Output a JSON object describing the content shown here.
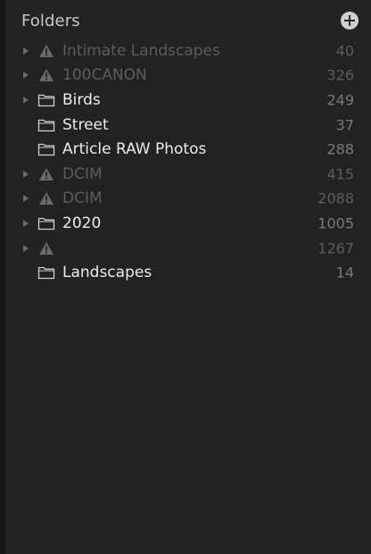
{
  "panel": {
    "title": "Folders"
  },
  "folders": [
    {
      "name": "Intimate Landscapes",
      "count": "40",
      "status": "missing",
      "expandable": true,
      "icon": "warning-icon"
    },
    {
      "name": "100CANON",
      "count": "326",
      "status": "missing",
      "expandable": true,
      "icon": "warning-icon"
    },
    {
      "name": "Birds",
      "count": "249",
      "status": "ok",
      "expandable": true,
      "icon": "folder-icon"
    },
    {
      "name": "Street",
      "count": "37",
      "status": "ok",
      "expandable": false,
      "icon": "folder-icon"
    },
    {
      "name": "Article RAW Photos",
      "count": "288",
      "status": "ok",
      "expandable": false,
      "icon": "folder-icon"
    },
    {
      "name": "DCIM",
      "count": "415",
      "status": "missing",
      "expandable": true,
      "icon": "warning-icon"
    },
    {
      "name": "DCIM",
      "count": "2088",
      "status": "missing",
      "expandable": true,
      "icon": "warning-icon"
    },
    {
      "name": "2020",
      "count": "1005",
      "status": "ok",
      "expandable": true,
      "icon": "folder-icon"
    },
    {
      "name": "",
      "count": "1267",
      "status": "missing",
      "expandable": true,
      "icon": "warning-icon"
    },
    {
      "name": "Landscapes",
      "count": "14",
      "status": "ok",
      "expandable": false,
      "icon": "folder-icon"
    }
  ],
  "colors": {
    "background": "#222222",
    "text_active": "#ececec",
    "text_missing": "#5d5d5d",
    "count": "#7a7a7a"
  }
}
